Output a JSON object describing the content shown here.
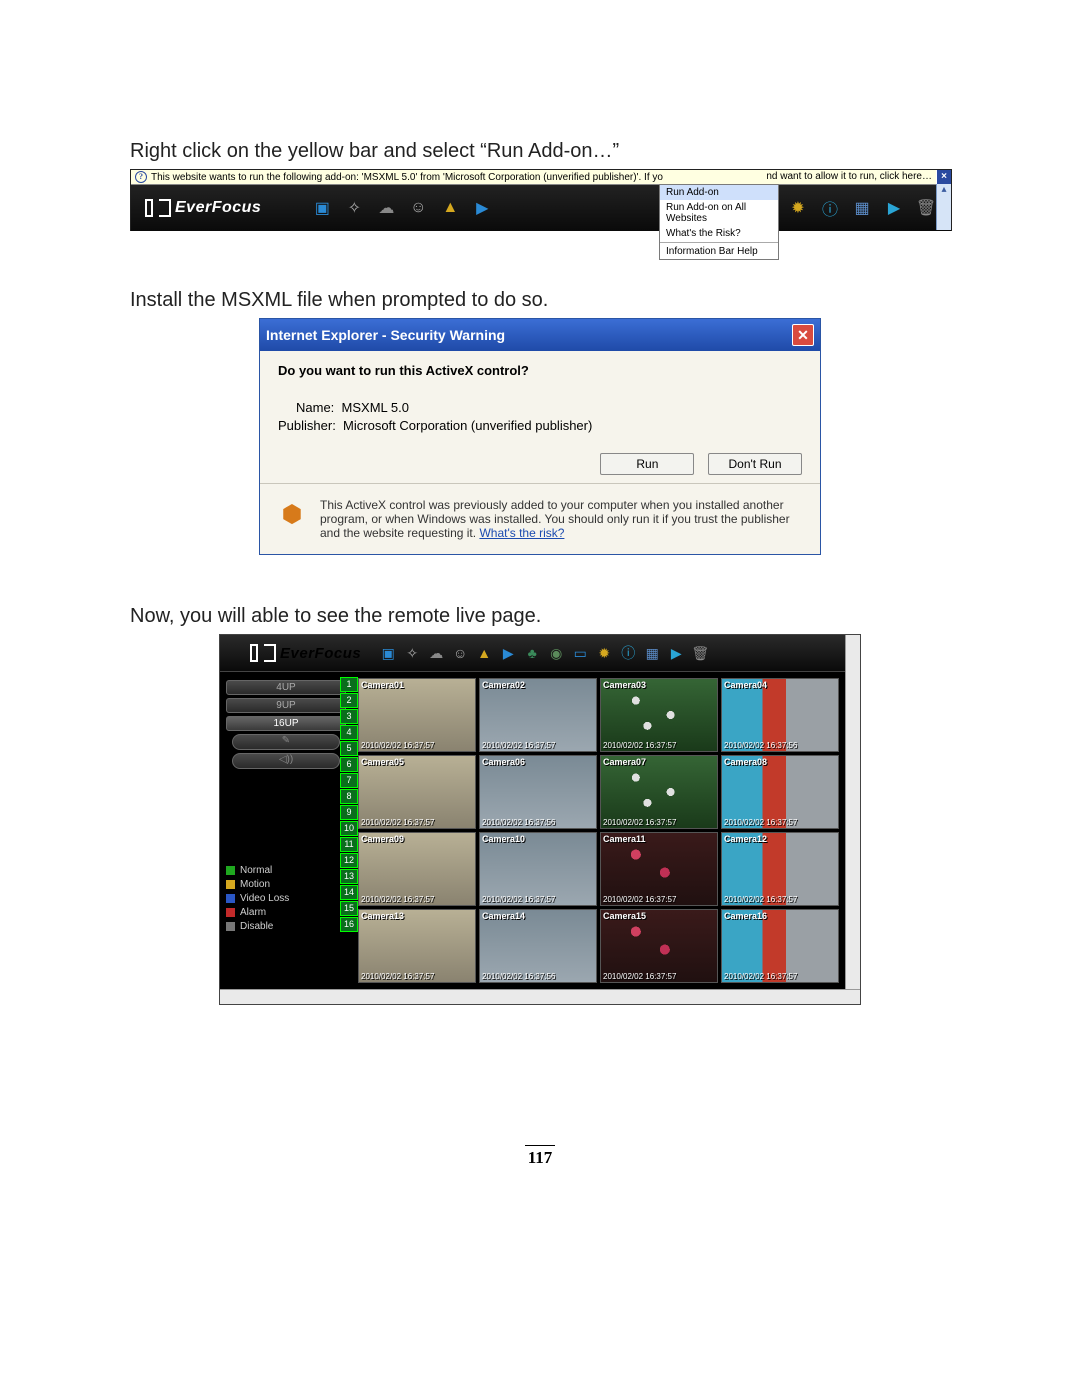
{
  "instructions": {
    "s1": "Right click on the yellow bar and select “Run Add-on…”",
    "s2": "Install the MSXML file when prompted to do so.",
    "s3": "Now, you will able to see the remote live page."
  },
  "yellowbar": {
    "left": "This website wants to run the following add-on: 'MSXML 5.0' from 'Microsoft Corporation (unverified publisher)'. If yo",
    "right": "nd want to allow it to run, click here…"
  },
  "logo": "EverFocus",
  "contextmenu": {
    "run": "Run Add-on",
    "runall": "Run Add-on on All Websites",
    "risk": "What's the Risk?",
    "help": "Information Bar Help"
  },
  "dialog": {
    "title": "Internet Explorer - Security Warning",
    "question": "Do you want to run this ActiveX control?",
    "name_lbl": "Name:",
    "name_val": "MSXML 5.0",
    "pub_lbl": "Publisher:",
    "pub_val": "Microsoft Corporation (unverified publisher)",
    "run": "Run",
    "dontrun": "Don't Run",
    "warn": "This ActiveX control was previously added to your computer when you installed another program, or when Windows was installed. You should only run it if you trust the publisher and the website requesting it.  ",
    "warn_link": "What's the risk?"
  },
  "live": {
    "up": [
      "4UP",
      "9UP",
      "16UP"
    ],
    "nums": [
      "1",
      "2",
      "3",
      "4",
      "5",
      "6",
      "7",
      "8",
      "9",
      "10",
      "11",
      "12",
      "13",
      "14",
      "15",
      "16"
    ],
    "legend": [
      {
        "c": "#1fa81f",
        "t": "Normal"
      },
      {
        "c": "#d5a81f",
        "t": "Motion"
      },
      {
        "c": "#2a57c5",
        "t": "Video Loss"
      },
      {
        "c": "#c22a2a",
        "t": "Alarm"
      },
      {
        "c": "#777",
        "t": "Disable"
      }
    ],
    "cams": [
      {
        "n": "Camera01",
        "t": "2010/02/02 16:37:57",
        "c": "cfloor"
      },
      {
        "n": "Camera02",
        "t": "2010/02/02 16:37:57",
        "c": "cstairs"
      },
      {
        "n": "Camera03",
        "t": "2010/02/02 16:37:57",
        "c": "cflower"
      },
      {
        "n": "Camera04",
        "t": "2010/02/02 16:37:56",
        "c": "coffice"
      },
      {
        "n": "Camera05",
        "t": "2010/02/02 16:37:57",
        "c": "cfloor"
      },
      {
        "n": "Camera06",
        "t": "2010/02/02 16:37:56",
        "c": "cstairs"
      },
      {
        "n": "Camera07",
        "t": "2010/02/02 16:37:57",
        "c": "cflower"
      },
      {
        "n": "Camera08",
        "t": "2010/02/02 16:37:57",
        "c": "coffice"
      },
      {
        "n": "Camera09",
        "t": "2010/02/02 16:37:57",
        "c": "cfloor"
      },
      {
        "n": "Camera10",
        "t": "2010/02/02 16:37:57",
        "c": "cstairs"
      },
      {
        "n": "Camera11",
        "t": "2010/02/02 16:37:57",
        "c": "cflower pink"
      },
      {
        "n": "Camera12",
        "t": "2010/02/02 16:37:57",
        "c": "coffice"
      },
      {
        "n": "Camera13",
        "t": "2010/02/02 16:37:57",
        "c": "cfloor"
      },
      {
        "n": "Camera14",
        "t": "2010/02/02 16:37:56",
        "c": "cstairs"
      },
      {
        "n": "Camera15",
        "t": "2010/02/02 16:37:57",
        "c": "cflower pink"
      },
      {
        "n": "Camera16",
        "t": "2010/02/02 16:37:57",
        "c": "coffice"
      }
    ]
  },
  "pagenum": "117"
}
